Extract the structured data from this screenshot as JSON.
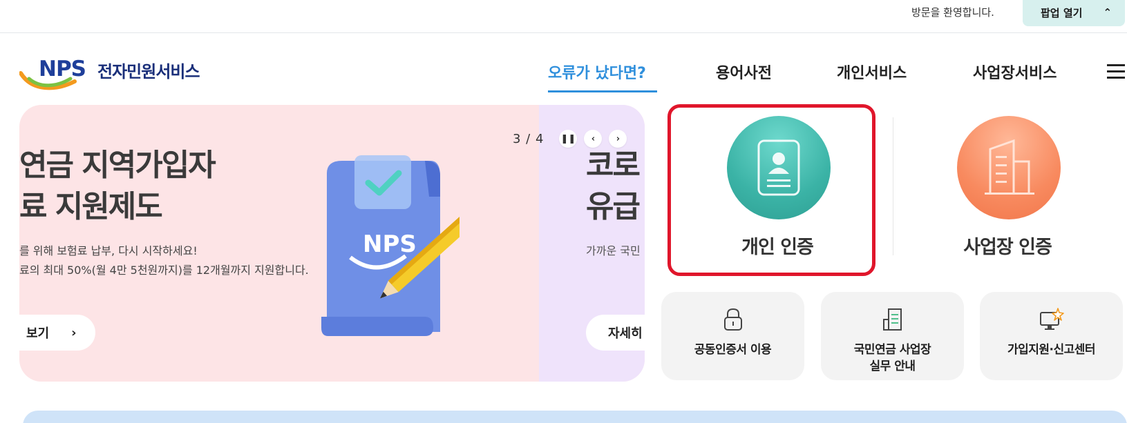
{
  "utility": {
    "welcome": "방문을 환영합니다.",
    "popup_label": "팝업 열기",
    "popup_icon": "chevron-up-icon"
  },
  "header": {
    "logo_mark": "NPS",
    "logo_text": "전자민원서비스",
    "nav": [
      {
        "label": "오류가 났다면?",
        "active": true
      },
      {
        "label": "용어사전",
        "active": false
      },
      {
        "label": "개인서비스",
        "active": false
      },
      {
        "label": "사업장서비스",
        "active": false
      }
    ],
    "menu_icon": "hamburger-menu-icon"
  },
  "banner": {
    "counter": "3 / 4",
    "controls": [
      "pause-icon",
      "chevron-left-icon",
      "chevron-right-icon"
    ],
    "slide": {
      "title_line1": "연금 지역가입자",
      "title_line2": "료 지원제도",
      "desc_line1": "를 위해 보험료 납부, 다시 시작하세요!",
      "desc_line2": "료의 최대 50%(월 4만 5천원까지)를 12개월까지 지원합니다.",
      "button_label": "보기",
      "illustration_text": "NPS"
    },
    "next_slide": {
      "title_line1": "코로",
      "title_line2": "유급",
      "desc": "가까운 국민",
      "button_label": "자세히"
    },
    "colors": {
      "current_bg": "#fde4e6",
      "next_bg": "#efe3fb"
    }
  },
  "auth": {
    "personal_label": "개인 인증",
    "business_label": "사업장 인증",
    "personal_color": "#3bb3a6",
    "business_color": "#f88a5f",
    "highlight_color": "#e0162b"
  },
  "services": [
    {
      "icon": "lock-icon",
      "line1": "공동인증서 이용",
      "line2": ""
    },
    {
      "icon": "document-building-icon",
      "line1": "국민연금 사업장",
      "line2": "실무 안내"
    },
    {
      "icon": "monitor-star-icon",
      "line1": "가입지원·신고센터",
      "line2": ""
    }
  ],
  "accent_color": "#2f8fdc"
}
